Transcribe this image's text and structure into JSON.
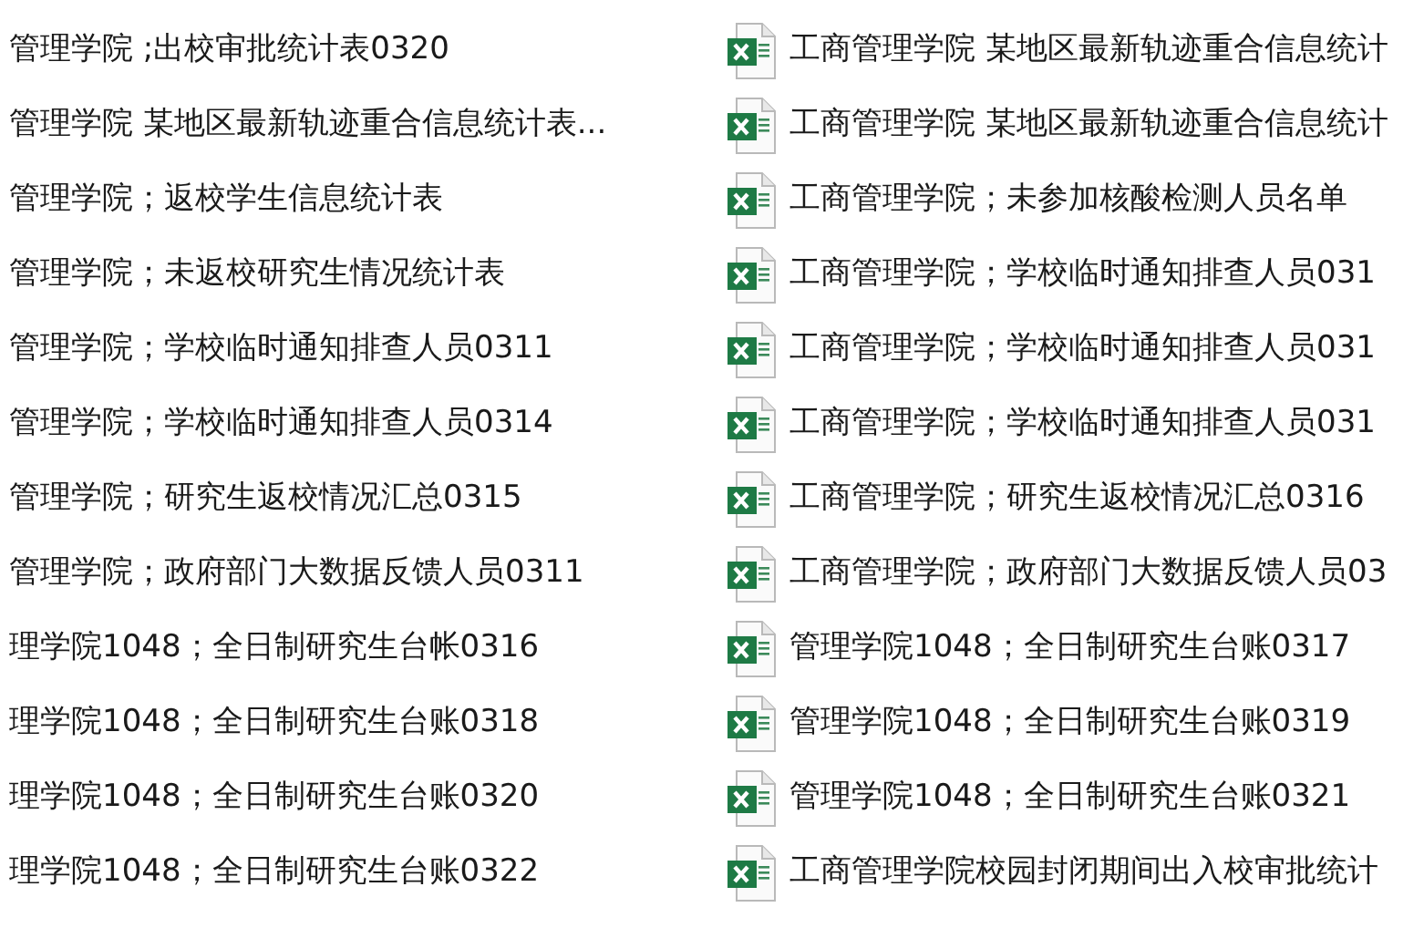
{
  "columns": [
    {
      "files": [
        {
          "name": "管理学院 ;出校审批统计表0320",
          "kind": "none"
        },
        {
          "name": "管理学院 某地区最新轨迹重合信息统计表...",
          "kind": "none"
        },
        {
          "name": "管理学院；返校学生信息统计表",
          "kind": "none"
        },
        {
          "name": "管理学院；未返校研究生情况统计表",
          "kind": "none"
        },
        {
          "name": "管理学院；学校临时通知排查人员0311",
          "kind": "none"
        },
        {
          "name": "管理学院；学校临时通知排查人员0314",
          "kind": "none"
        },
        {
          "name": "管理学院；研究生返校情况汇总0315",
          "kind": "none"
        },
        {
          "name": "管理学院；政府部门大数据反馈人员0311",
          "kind": "none"
        },
        {
          "name": "理学院1048；全日制研究生台帐0316",
          "kind": "none"
        },
        {
          "name": "理学院1048；全日制研究生台账0318",
          "kind": "none"
        },
        {
          "name": "理学院1048；全日制研究生台账0320",
          "kind": "none"
        },
        {
          "name": "理学院1048；全日制研究生台账0322",
          "kind": "none"
        }
      ]
    },
    {
      "files": [
        {
          "name": "工商管理学院 某地区最新轨迹重合信息统计",
          "kind": "excel"
        },
        {
          "name": "工商管理学院 某地区最新轨迹重合信息统计",
          "kind": "excel"
        },
        {
          "name": "工商管理学院；未参加核酸检测人员名单",
          "kind": "excel"
        },
        {
          "name": "工商管理学院；学校临时通知排查人员031",
          "kind": "excel"
        },
        {
          "name": "工商管理学院；学校临时通知排查人员031",
          "kind": "excel"
        },
        {
          "name": "工商管理学院；学校临时通知排查人员031",
          "kind": "excel"
        },
        {
          "name": "工商管理学院；研究生返校情况汇总0316",
          "kind": "excel"
        },
        {
          "name": "工商管理学院；政府部门大数据反馈人员03",
          "kind": "excel"
        },
        {
          "name": "管理学院1048；全日制研究生台账0317",
          "kind": "excel"
        },
        {
          "name": "管理学院1048；全日制研究生台账0319",
          "kind": "excel"
        },
        {
          "name": "管理学院1048；全日制研究生台账0321",
          "kind": "excel"
        },
        {
          "name": "工商管理学院校园封闭期间出入校审批统计",
          "kind": "excel"
        }
      ]
    }
  ]
}
